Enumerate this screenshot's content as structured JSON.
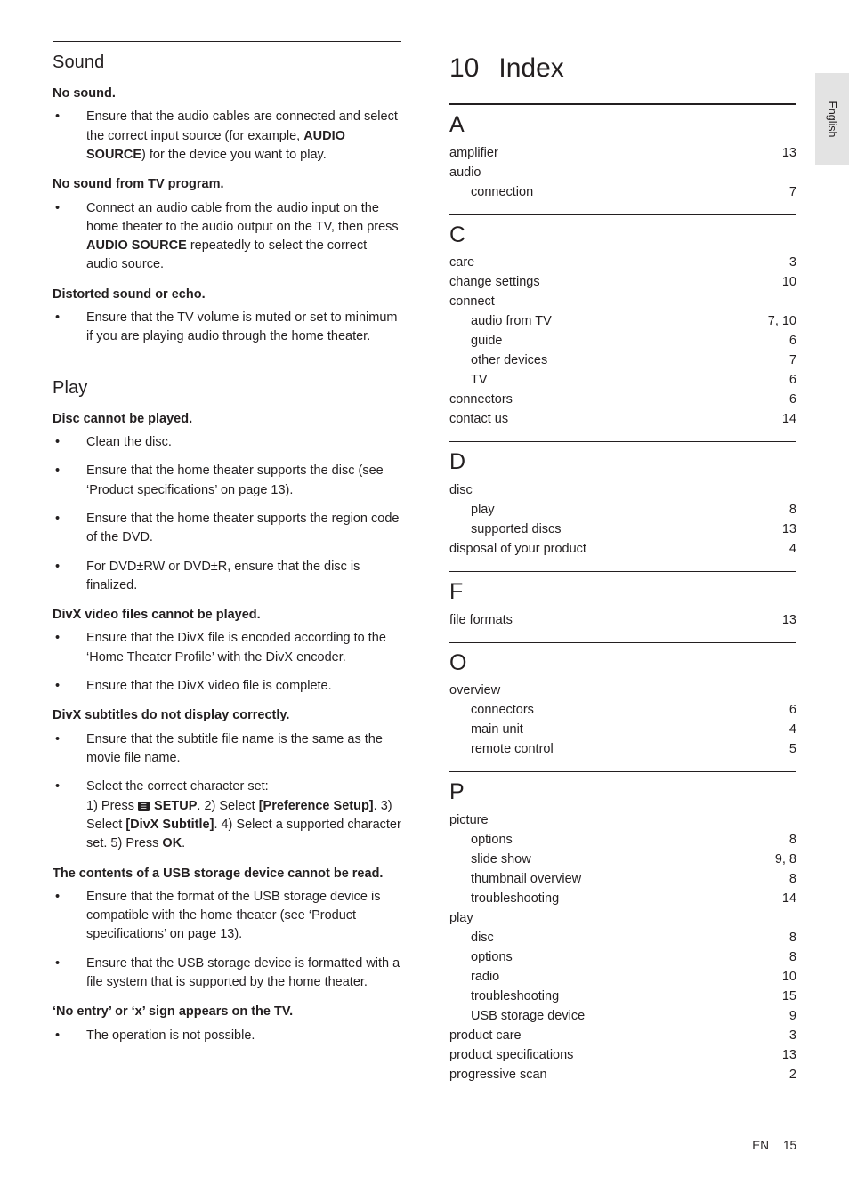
{
  "left_column": {
    "sections": [
      {
        "title": "Sound",
        "blocks": [
          {
            "question": "No sound.",
            "items": [
              "Ensure that the audio cables are connected and select the correct input source (for example, <b>AUDIO SOURCE</b>) for the device you want to play."
            ]
          },
          {
            "question": "No sound from TV program.",
            "items": [
              "Connect an audio cable from the audio input on the home theater to the audio output on the TV, then press <b>AUDIO SOURCE</b> repeatedly to select the correct audio source."
            ]
          },
          {
            "question": "Distorted sound or echo.",
            "items": [
              "Ensure that the TV volume is muted or set to minimum if you are playing audio through the home theater."
            ]
          }
        ]
      },
      {
        "title": "Play",
        "blocks": [
          {
            "question": "Disc cannot be played.",
            "items": [
              "Clean the disc.",
              "Ensure that the home theater supports the disc (see &lsquo;Product specifications&rsquo; on page 13).",
              "Ensure that the home theater supports the region code of the DVD.",
              "For DVD&plusmn;RW or DVD&plusmn;R, ensure that the disc is finalized."
            ]
          },
          {
            "question": "DivX video files cannot be played.",
            "items": [
              "Ensure that the DivX file is encoded according to the &lsquo;Home Theater Profile&rsquo; with the DivX encoder.",
              "Ensure that the DivX video file is complete."
            ]
          },
          {
            "question": "DivX subtitles do not display correctly.",
            "items": [
              "Ensure that the subtitle file name is the same as the movie file name.",
              "Select the correct character set:<br>1) Press <span class=\"setup-icon\">&#9776;</span> <b>SETUP</b>. 2) Select <b>[Preference Setup]</b>. 3) Select <b>[DivX Subtitle]</b>. 4) Select a supported character set. 5) Press <b>OK</b>."
            ]
          },
          {
            "question": "The contents of a USB storage device cannot be read.",
            "items": [
              "Ensure that the format of the USB storage device is compatible with the home theater (see &lsquo;Product specifications&rsquo; on page 13).",
              "Ensure that the USB storage device is formatted with a file system that is supported by the home theater."
            ]
          },
          {
            "question": "&lsquo;No entry&rsquo; or &lsquo;x&rsquo; sign appears on the TV.",
            "items": [
              "The operation is not possible."
            ]
          }
        ]
      }
    ]
  },
  "index": {
    "chapter_number": "10",
    "chapter_title": "Index",
    "groups": [
      {
        "letter": "A",
        "entries": [
          {
            "label": "amplifier",
            "page": "13",
            "indent": false
          },
          {
            "label": "audio",
            "page": "",
            "indent": false
          },
          {
            "label": "connection",
            "page": "7",
            "indent": true
          }
        ]
      },
      {
        "letter": "C",
        "entries": [
          {
            "label": "care",
            "page": "3",
            "indent": false
          },
          {
            "label": "change settings",
            "page": "10",
            "indent": false
          },
          {
            "label": "connect",
            "page": "",
            "indent": false
          },
          {
            "label": "audio from TV",
            "page": "7, 10",
            "indent": true
          },
          {
            "label": "guide",
            "page": "6",
            "indent": true
          },
          {
            "label": "other devices",
            "page": "7",
            "indent": true
          },
          {
            "label": "TV",
            "page": "6",
            "indent": true
          },
          {
            "label": "connectors",
            "page": "6",
            "indent": false
          },
          {
            "label": "contact us",
            "page": "14",
            "indent": false
          }
        ]
      },
      {
        "letter": "D",
        "entries": [
          {
            "label": "disc",
            "page": "",
            "indent": false
          },
          {
            "label": "play",
            "page": "8",
            "indent": true
          },
          {
            "label": "supported discs",
            "page": "13",
            "indent": true
          },
          {
            "label": "disposal of your product",
            "page": "4",
            "indent": false
          }
        ]
      },
      {
        "letter": "F",
        "entries": [
          {
            "label": "file formats",
            "page": "13",
            "indent": false
          }
        ]
      },
      {
        "letter": "O",
        "entries": [
          {
            "label": "overview",
            "page": "",
            "indent": false
          },
          {
            "label": "connectors",
            "page": "6",
            "indent": true
          },
          {
            "label": "main unit",
            "page": "4",
            "indent": true
          },
          {
            "label": "remote control",
            "page": "5",
            "indent": true
          }
        ]
      },
      {
        "letter": "P",
        "entries": [
          {
            "label": "picture",
            "page": "",
            "indent": false
          },
          {
            "label": "options",
            "page": "8",
            "indent": true
          },
          {
            "label": "slide show",
            "page": "9, 8",
            "indent": true
          },
          {
            "label": "thumbnail overview",
            "page": "8",
            "indent": true
          },
          {
            "label": "troubleshooting",
            "page": "14",
            "indent": true
          },
          {
            "label": "play",
            "page": "",
            "indent": false
          },
          {
            "label": "disc",
            "page": "8",
            "indent": true
          },
          {
            "label": "options",
            "page": "8",
            "indent": true
          },
          {
            "label": "radio",
            "page": "10",
            "indent": true
          },
          {
            "label": "troubleshooting",
            "page": "15",
            "indent": true
          },
          {
            "label": "USB storage device",
            "page": "9",
            "indent": true
          },
          {
            "label": "product care",
            "page": "3",
            "indent": false
          },
          {
            "label": "product specifications",
            "page": "13",
            "indent": false
          },
          {
            "label": "progressive scan",
            "page": "2",
            "indent": false
          }
        ]
      }
    ]
  },
  "side_tab": {
    "label": "English"
  },
  "footer": {
    "language_code": "EN",
    "page_number": "15"
  }
}
